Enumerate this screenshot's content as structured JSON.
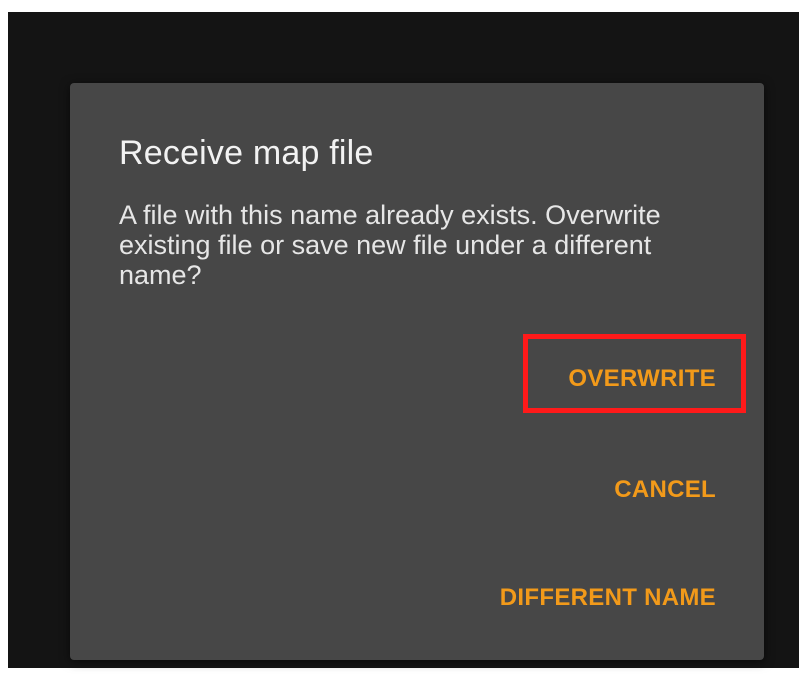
{
  "dialog": {
    "title": "Receive map file",
    "message": "A file with this name already exists. Overwrite existing file or save new file under a different name?",
    "buttons": {
      "overwrite": "OVERWRITE",
      "cancel": "CANCEL",
      "different_name": "DIFFERENT NAME"
    },
    "highlighted_button": "overwrite"
  },
  "colors": {
    "backdrop": "#141414",
    "dialog_background": "#474747",
    "title_text": "#f2f2f2",
    "button_text": "#f29a1a",
    "highlight_border": "#ff1a1a"
  }
}
